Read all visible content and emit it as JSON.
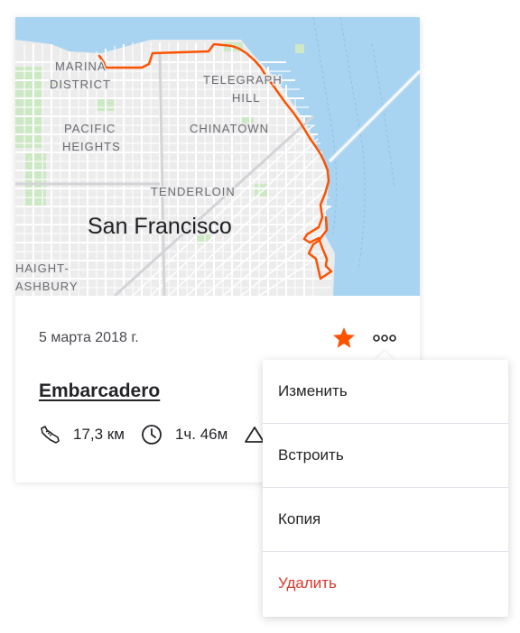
{
  "route": {
    "date": "5 марта 2018 г.",
    "title": "Embarcadero",
    "distance": "17,3 км",
    "duration": "1ч. 46м",
    "map": {
      "city_label": "San Francisco",
      "neighborhoods": [
        "MARINA",
        "DISTRICT",
        "TELEGRAPH",
        "HILL",
        "PACIFIC",
        "HEIGHTS",
        "CHINATOWN",
        "TENDERLOIN",
        "HAIGHT-",
        "ASHBURY"
      ],
      "route_color": "#fc5200",
      "water_color": "#a8d4f2",
      "land_color": "#ececec"
    }
  },
  "actions": {
    "star_icon": "star-icon",
    "more_icon": "more-dots-icon",
    "accent_color": "#fc5200"
  },
  "menu": {
    "items": [
      {
        "label": "Изменить"
      },
      {
        "label": "Встроить"
      },
      {
        "label": "Копия"
      },
      {
        "label": "Удалить",
        "danger_color": "#d9382c"
      }
    ]
  }
}
